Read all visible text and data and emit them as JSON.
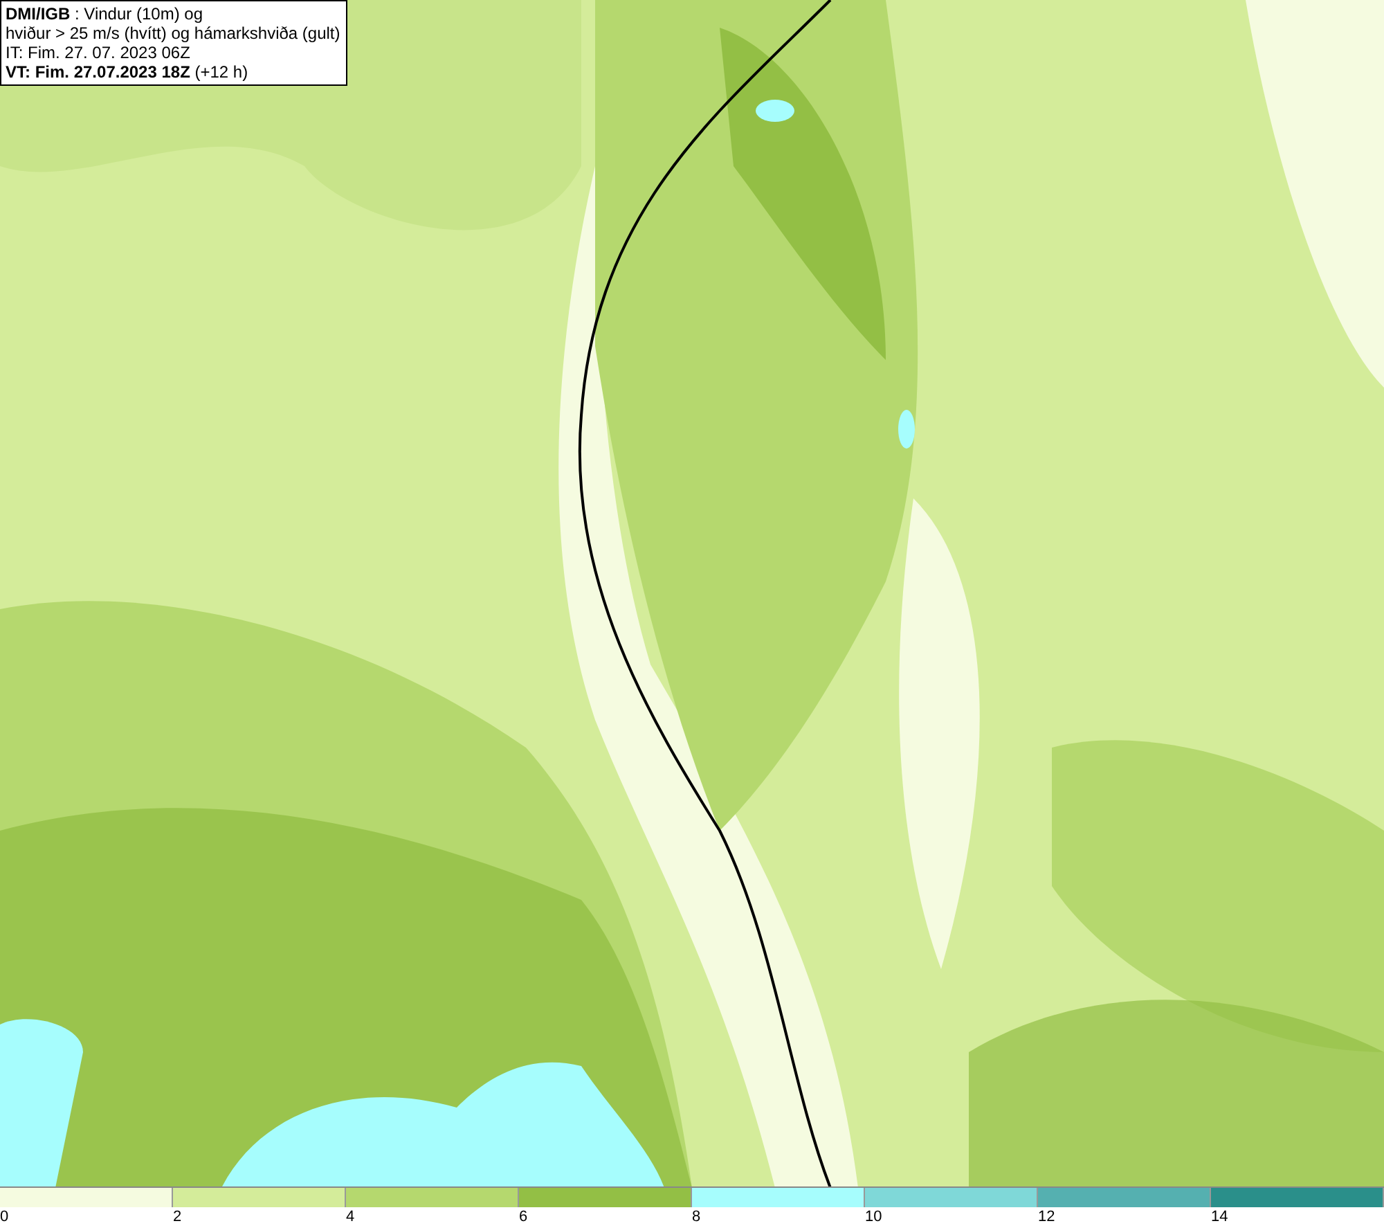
{
  "title_box": {
    "lines": [
      "**DMI/IGB** : Vindur (10m) og",
      "hviður > 25 m/s (hvítt) og hámarkshviða (gult)",
      "IT: Fim. 27. 07. 2023 06Z",
      "**VT: Fim. 27.07.2023 18Z** (+12 h)"
    ]
  },
  "legend": {
    "segments": [
      {
        "label": "0",
        "color": "#f5fbe0"
      },
      {
        "label": "2",
        "color": "#d4ec9a"
      },
      {
        "label": "4",
        "color": "#b5d86e"
      },
      {
        "label": "6",
        "color": "#93bf45"
      },
      {
        "label": "8",
        "color": "#a6fdfd"
      },
      {
        "label": "10",
        "color": "#7fd8d8"
      },
      {
        "label": "12",
        "color": "#55b0b0"
      },
      {
        "label": "14",
        "color": "#2a8f8a"
      }
    ]
  }
}
